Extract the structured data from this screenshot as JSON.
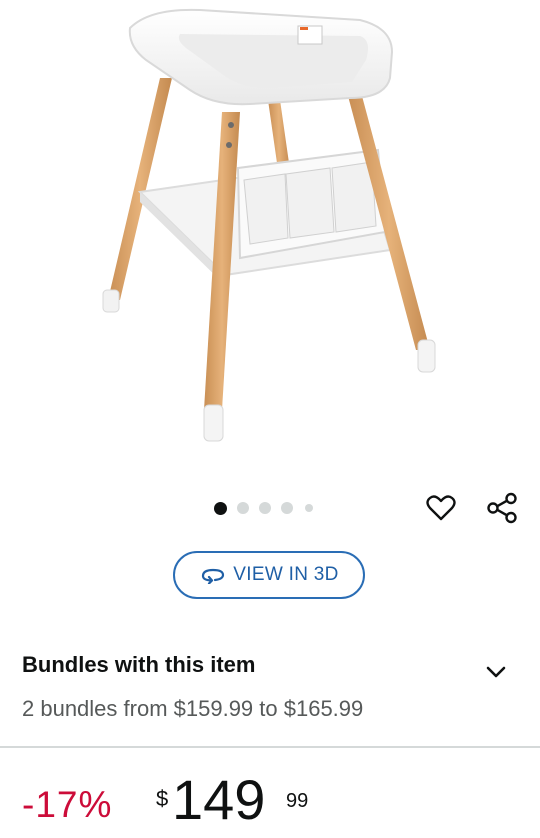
{
  "product": {
    "image_alt": "White baby changing table with natural wood legs and lower shelf with storage pockets"
  },
  "carousel": {
    "total_images": 5,
    "active_index": 0
  },
  "actions": {
    "favorite_icon": "heart-outline-icon",
    "share_icon": "share-icon"
  },
  "view3d": {
    "label": "VIEW IN 3D",
    "icon": "rotate-3d-icon",
    "color": "#1f5fa6"
  },
  "bundles": {
    "title": "Bundles with this item",
    "subtitle": "2 bundles from $159.99 to $165.99",
    "expand_icon": "chevron-down-icon"
  },
  "price": {
    "discount": "-17%",
    "currency": "$",
    "whole": "149",
    "fraction": "99",
    "discount_color": "#cc0c39"
  }
}
